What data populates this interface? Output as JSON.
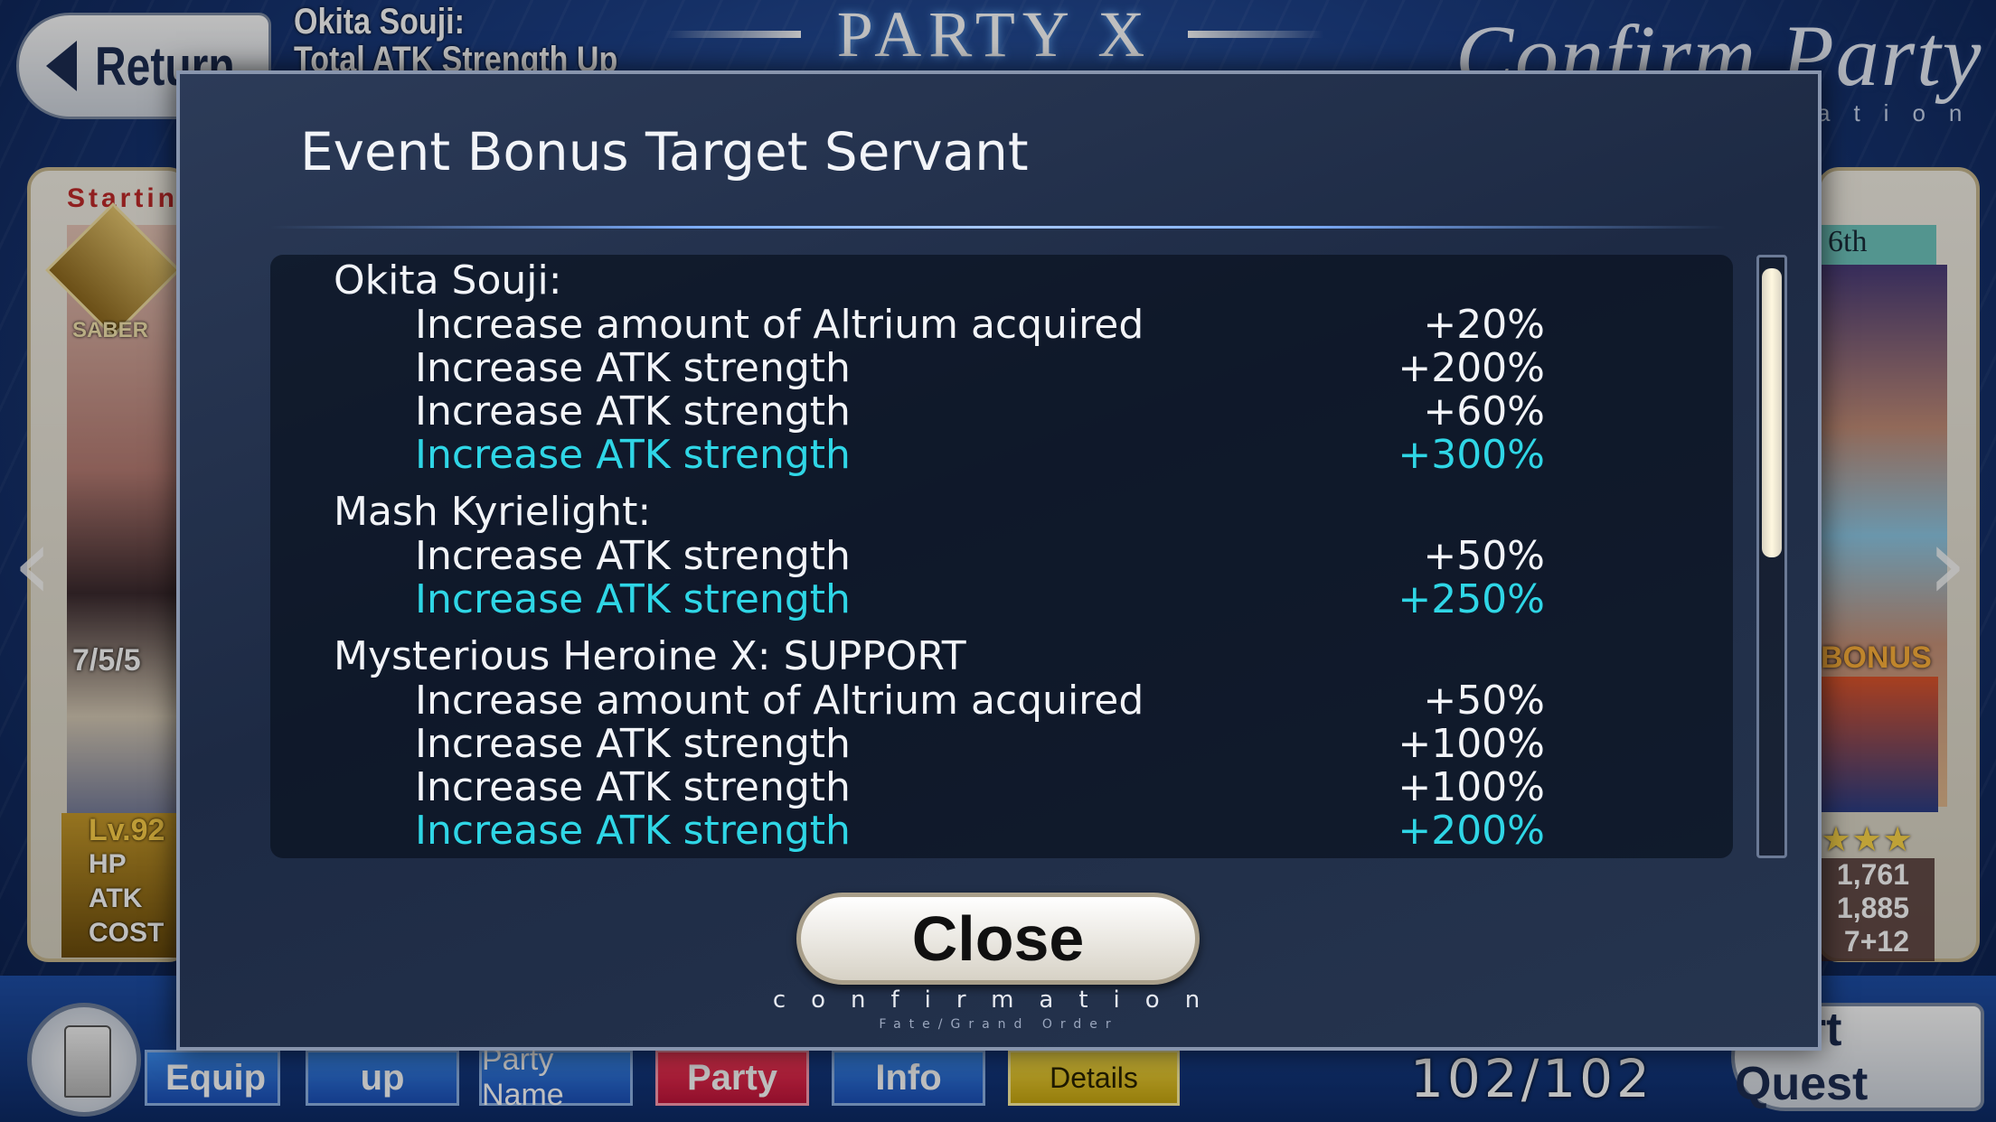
{
  "header": {
    "return_label": "Return",
    "servant_info_name": "Okita Souji:",
    "servant_info_effect": "Total ATK Strength Up",
    "party_title": "PARTY X",
    "screen_title": "Confirm Party",
    "screen_subtitle": "ation"
  },
  "left_card": {
    "starting_label": "Startin",
    "class_label": "SABER",
    "skill_levels": "7/5/5",
    "level": "Lv.92",
    "stat_labels": [
      "HP",
      "ATK",
      "COST"
    ]
  },
  "right_card": {
    "slot_label": "6th",
    "bonus_label": "BONUS",
    "stars": "★★★",
    "hp": "1,761",
    "atk": "1,885",
    "cost": "7+12"
  },
  "bottom_bar": {
    "equip_label": "Equip",
    "lineup_label": "up",
    "party_name_label": "Party Name",
    "party_label": "Party",
    "info_label": "Info",
    "details_label": "Details",
    "page_count": "102/102",
    "start_quest_label": "Start Quest"
  },
  "modal": {
    "title": "Event Bonus Target Servant",
    "servants": [
      {
        "name": "Okita Souji:",
        "bonuses": [
          {
            "label": "Increase amount of Altrium acquired",
            "value": "+20%",
            "highlight": false
          },
          {
            "label": "Increase ATK strength",
            "value": "+200%",
            "highlight": false
          },
          {
            "label": "Increase ATK strength",
            "value": "+60%",
            "highlight": false
          },
          {
            "label": "Increase ATK strength",
            "value": "+300%",
            "highlight": true
          }
        ]
      },
      {
        "name": "Mash Kyrielight:",
        "bonuses": [
          {
            "label": "Increase ATK strength",
            "value": "+50%",
            "highlight": false
          },
          {
            "label": "Increase ATK strength",
            "value": "+250%",
            "highlight": true
          }
        ]
      },
      {
        "name": "Mysterious Heroine X: SUPPORT",
        "bonuses": [
          {
            "label": "Increase amount of Altrium acquired",
            "value": "+50%",
            "highlight": false
          },
          {
            "label": "Increase ATK strength",
            "value": "+100%",
            "highlight": false
          },
          {
            "label": "Increase ATK strength",
            "value": "+100%",
            "highlight": false
          },
          {
            "label": "Increase ATK strength",
            "value": "+200%",
            "highlight": true
          }
        ]
      }
    ],
    "close_label": "Close",
    "close_sublabel": "confirmation",
    "close_sublabel2": "Fate/Grand Order"
  },
  "colors": {
    "highlight": "#2fd6e6",
    "text": "#f2f4f8"
  }
}
